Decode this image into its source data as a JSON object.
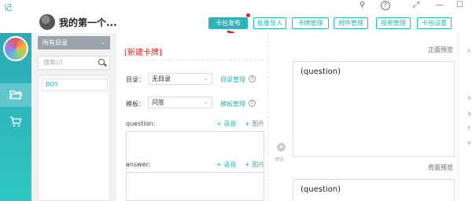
{
  "window": {
    "app_logo": "记",
    "controls": {
      "pin": "⚲",
      "help": "?",
      "expand": "⤢",
      "minimize": "—",
      "maximize": "☐"
    }
  },
  "header": {
    "deck_title": "我的第一个...",
    "buttons": [
      {
        "label": "卡包发布",
        "active": true
      },
      {
        "label": "批量导入",
        "active": false
      },
      {
        "label": "卡牌管理",
        "active": false
      },
      {
        "label": "附件管理",
        "active": false
      },
      {
        "label": "视频管理",
        "active": false
      },
      {
        "label": "卡包设置",
        "active": false
      }
    ]
  },
  "rail": {
    "items": [
      {
        "icon": "folder-icon"
      },
      {
        "icon": "cart-icon"
      }
    ]
  },
  "directory": {
    "select_label": "所有目录",
    "search_placeholder": "搜索(/)",
    "items": [
      {
        "label": "BOY"
      }
    ]
  },
  "editor": {
    "title": "[新建卡牌]",
    "catalog_label": "目录：",
    "catalog_value": "无目录",
    "catalog_manage": "目录管理",
    "template_label": "模板：",
    "template_value": "问答",
    "template_manage": "模板管理",
    "question_label": "question:",
    "answer_label": "answer:",
    "add_audio": "+ 语音",
    "add_image": "+ 图片"
  },
  "middle": {
    "preview_label": "预览"
  },
  "preview": {
    "front_label": "正面预览",
    "back_label": "背面预览",
    "front_content": "(question)",
    "back_content": "(question)"
  },
  "right_strip": {
    "items": [
      "t",
      "h",
      "S",
      "t",
      "F"
    ]
  },
  "colors": {
    "accent": "#2bb5b8",
    "title_red": "#e02020",
    "rail_top": "#2ea9b6",
    "rail_bottom": "#2fc7c2"
  }
}
